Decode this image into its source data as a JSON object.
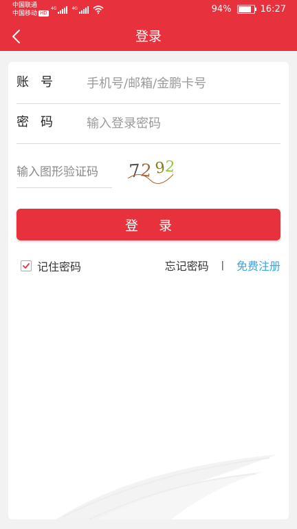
{
  "status_bar": {
    "carrier_1": "中国联通",
    "carrier_2": "中国移动",
    "hd_badge": "HD",
    "network_1": "4G",
    "network_2": "4G",
    "battery_text": "94%",
    "battery_level": 0.94,
    "time": "16:27"
  },
  "nav": {
    "title": "登录",
    "back_icon": "chevron-left-icon"
  },
  "form": {
    "account_label": "账号",
    "account_placeholder": "手机号/邮箱/金鹏卡号",
    "password_label": "密码",
    "password_placeholder": "输入登录密码",
    "captcha_placeholder": "输入图形验证码",
    "captcha_code": [
      "7",
      "2",
      "9",
      "2"
    ],
    "login_button": "登录",
    "remember_label": "记住密码",
    "remember_checked": true,
    "forgot_link": "忘记密码",
    "divider": "|",
    "register_link": "免费注册"
  },
  "colors": {
    "primary": "#e7313c",
    "link": "#3aa4dc",
    "background": "#f2f2f2"
  }
}
